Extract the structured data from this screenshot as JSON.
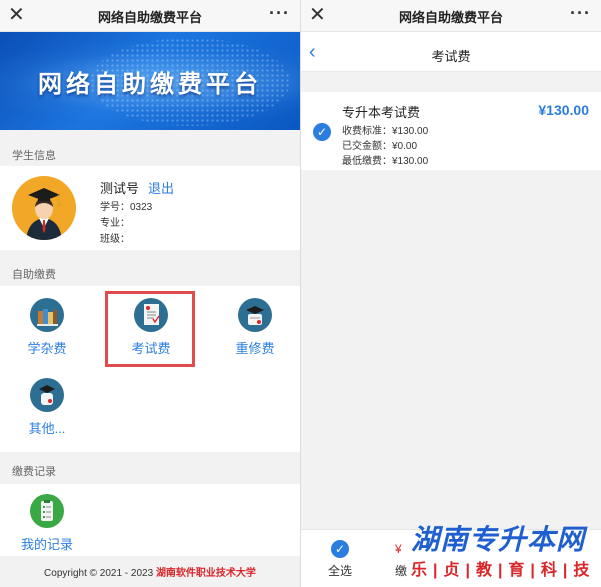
{
  "left": {
    "window_title": "网络自助缴费平台",
    "banner_text": "网络自助缴费平台",
    "student_section_label": "学生信息",
    "student": {
      "name": "测试号",
      "logout_label": "退出",
      "id_line": "学号：0323",
      "major_line": "专业：",
      "class_line": "班级："
    },
    "self_pay_section_label": "自助缴费",
    "tiles": [
      {
        "label": "学杂费",
        "icon": "books-icon"
      },
      {
        "label": "考试费",
        "icon": "exam-paper-icon"
      },
      {
        "label": "重修费",
        "icon": "retake-diploma-icon"
      },
      {
        "label": "其他...",
        "icon": "other-scroll-icon"
      }
    ],
    "record_section_label": "缴费记录",
    "record_tile": {
      "label": "我的记录",
      "icon": "clipboard-icon"
    },
    "copyright_prefix": "Copyright © 2021 - 2023 ",
    "copyright_school": "湖南软件职业技术大学"
  },
  "right": {
    "window_title": "网络自助缴费平台",
    "page_title": "考试费",
    "fee": {
      "title": "专升本考试费",
      "amount": "¥130.00",
      "standard": "收费标准：¥130.00",
      "paid": "已交金额：¥0.00",
      "minimum": "最低缴费：¥130.00"
    },
    "select_all_label": "全选",
    "pay_symbol": "¥",
    "pay_label_partial": "缴",
    "watermark_main": "湖南专升本网",
    "watermark_sub": "乐|贞|教|育|科|技"
  },
  "colors": {
    "accent": "#2b7de0",
    "highlight_border": "#e24b4b",
    "school_red": "#d8262b",
    "avatar_bg": "#f3a726",
    "icon_bg": "#2d6f93"
  }
}
